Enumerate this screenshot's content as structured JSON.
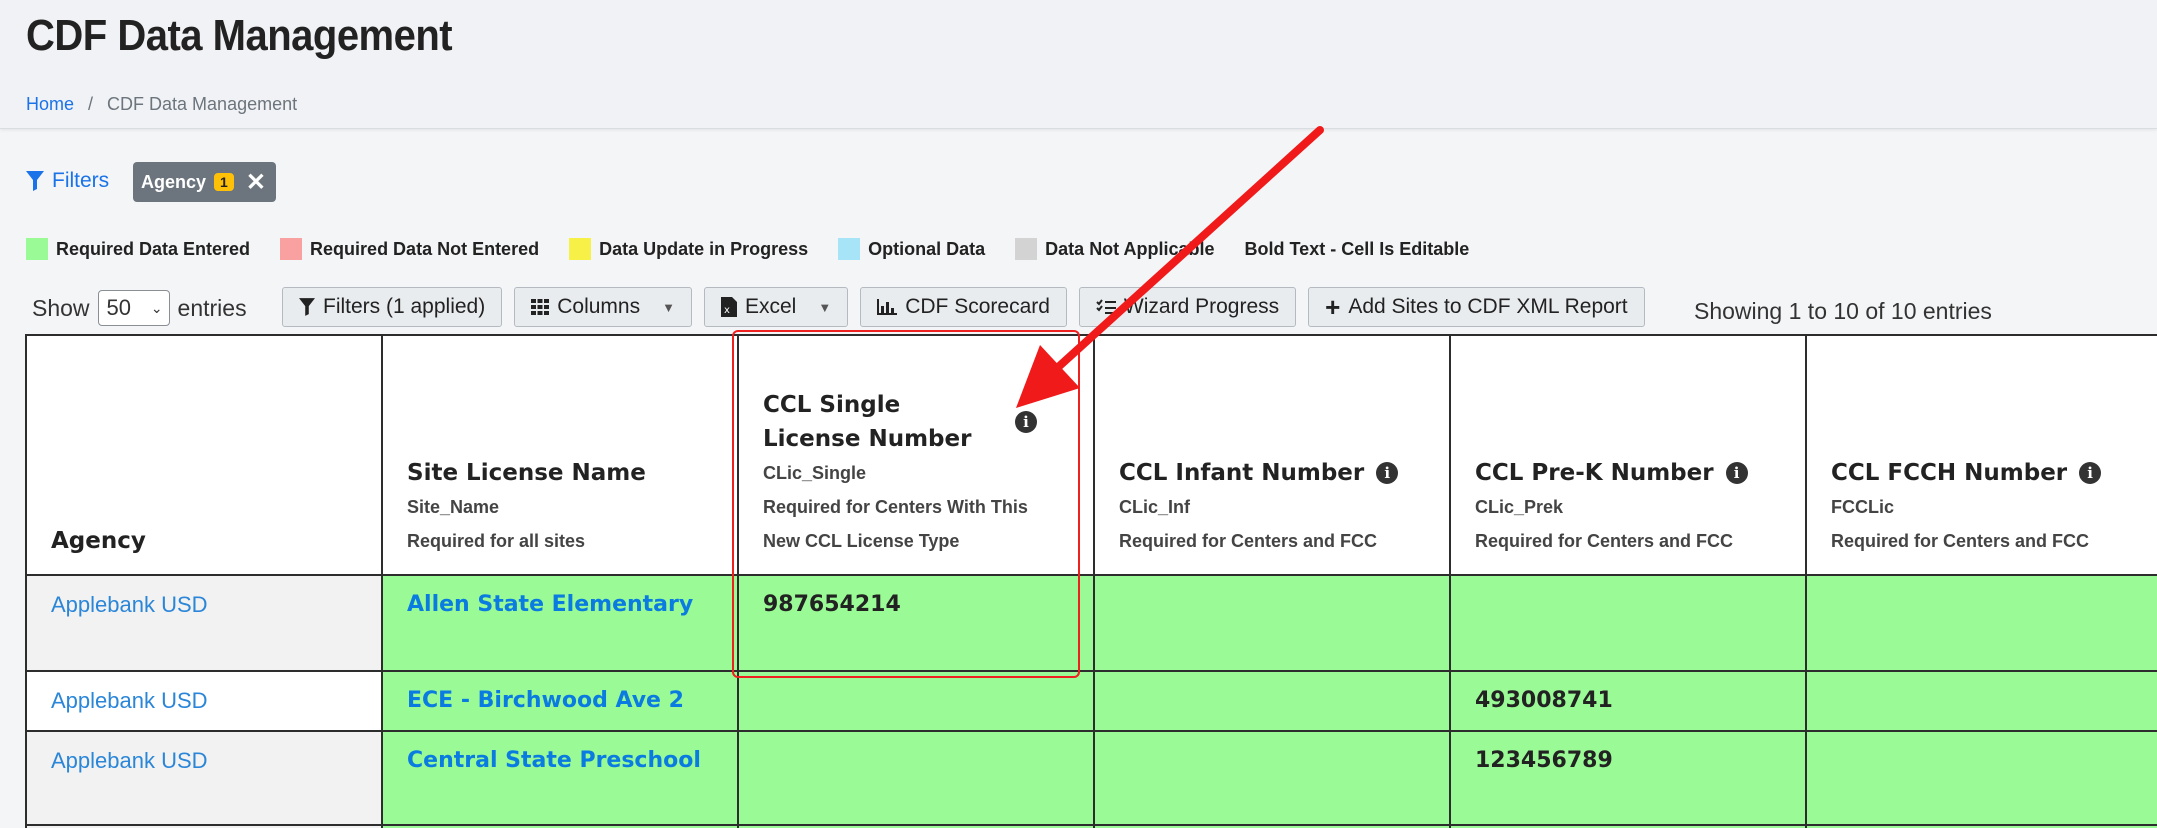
{
  "header": {
    "title": "CDF Data Management",
    "breadcrumb": {
      "home": "Home",
      "current": "CDF Data Management"
    }
  },
  "filters": {
    "label": "Filters",
    "chip_label": "Agency",
    "chip_count": "1"
  },
  "legend": [
    {
      "label": "Required Data Entered",
      "color": "#9afa95"
    },
    {
      "label": "Required Data Not Entered",
      "color": "#f9a0a0"
    },
    {
      "label": "Data Update in Progress",
      "color": "#f7f046"
    },
    {
      "label": "Optional Data",
      "color": "#a8e4f8"
    },
    {
      "label": "Data Not Applicable",
      "color": "#d3d3d3"
    }
  ],
  "legend_note": {
    "bold": "Bold Text",
    "rest": " - Cell Is Editable"
  },
  "show": {
    "prefix": "Show",
    "value": "50",
    "suffix": "entries"
  },
  "toolbar": {
    "filters": "Filters (1 applied)",
    "columns": "Columns",
    "excel": "Excel",
    "scorecard": "CDF Scorecard",
    "wizard": "Wizard Progress",
    "add_sites": "Add Sites to CDF XML Report"
  },
  "showing_text": "Showing 1 to 10 of 10 entries",
  "columns": [
    {
      "name": "Agency",
      "code": "",
      "note": ""
    },
    {
      "name": "Site License Name",
      "code": "Site_Name",
      "note": "Required for all sites"
    },
    {
      "name": "CCL Single License Number",
      "code": "CLic_Single",
      "note": "Required for Centers With This New CCL License Type"
    },
    {
      "name": "CCL Infant Number",
      "code": "CLic_Inf",
      "note": "Required for Centers and FCC"
    },
    {
      "name": "CCL Pre-K Number",
      "code": "CLic_Prek",
      "note": "Required for Centers and FCC"
    },
    {
      "name": "CCL FCCH Number",
      "code": "FCCLic",
      "note": "Required for Centers and FCC"
    }
  ],
  "rows": [
    {
      "agency": "Applebank USD",
      "site": "Allen State Elementary",
      "single": "987654214",
      "infant": "",
      "prek": "",
      "fcch": ""
    },
    {
      "agency": "Applebank USD",
      "site": "ECE - Birchwood Ave 2",
      "single": "",
      "infant": "",
      "prek": "493008741",
      "fcch": ""
    },
    {
      "agency": "Applebank USD",
      "site": "Central State Preschool",
      "single": "",
      "infant": "",
      "prek": "123456789",
      "fcch": ""
    }
  ]
}
